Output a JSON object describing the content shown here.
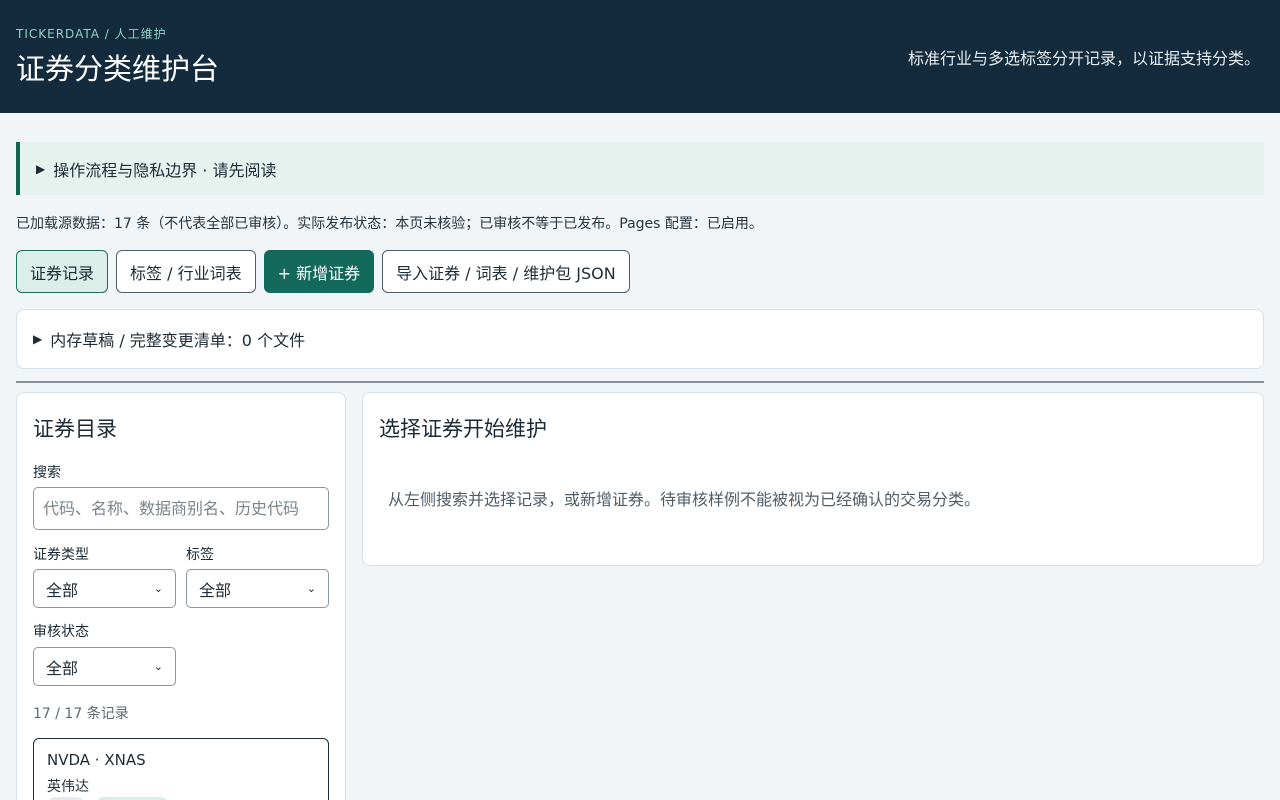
{
  "header": {
    "breadcrumb": "TICKERDATA / 人工维护",
    "title": "证券分类维护台",
    "tagline": "标准行业与多选标签分开记录，以证据支持分类。"
  },
  "guide": {
    "label": "操作流程与隐私边界 · 请先阅读"
  },
  "status_line": "已加载源数据：17 条（不代表全部已审核）。实际发布状态：本页未核验；已审核不等于已发布。Pages 配置：已启用。",
  "tabs": [
    {
      "label": "证券记录",
      "active": true
    },
    {
      "label": "标签 / 行业词表",
      "active": false
    },
    {
      "label": "+ 新增证券",
      "primary": true
    },
    {
      "label": "导入证券 / 词表 / 维护包 JSON",
      "active": false
    }
  ],
  "draft": {
    "label": "内存草稿 / 完整变更清单：0 个文件"
  },
  "sidebar": {
    "title": "证券目录",
    "search_label": "搜索",
    "search_placeholder": "代码、名称、数据商别名、历史代码",
    "type_label": "证券类型",
    "type_value": "全部",
    "tag_label": "标签",
    "tag_value": "全部",
    "review_label": "审核状态",
    "review_value": "全部",
    "count": "17 / 17 条记录",
    "records": [
      {
        "head": "NVDA · XNAS",
        "name": "英伟达"
      }
    ]
  },
  "main": {
    "title": "选择证券开始维护",
    "description": "从左侧搜索并选择记录，或新增证券。待审核样例不能被视为已经确认的交易分类。"
  },
  "colors": {
    "header_bg": "#132b3c",
    "accent": "#13695a",
    "breadcrumb": "#8fd3c3"
  },
  "icons": {
    "guide_toggle": "triangle-right-icon",
    "draft_toggle": "triangle-right-icon",
    "select_arrow": "chevron-down-icon"
  }
}
